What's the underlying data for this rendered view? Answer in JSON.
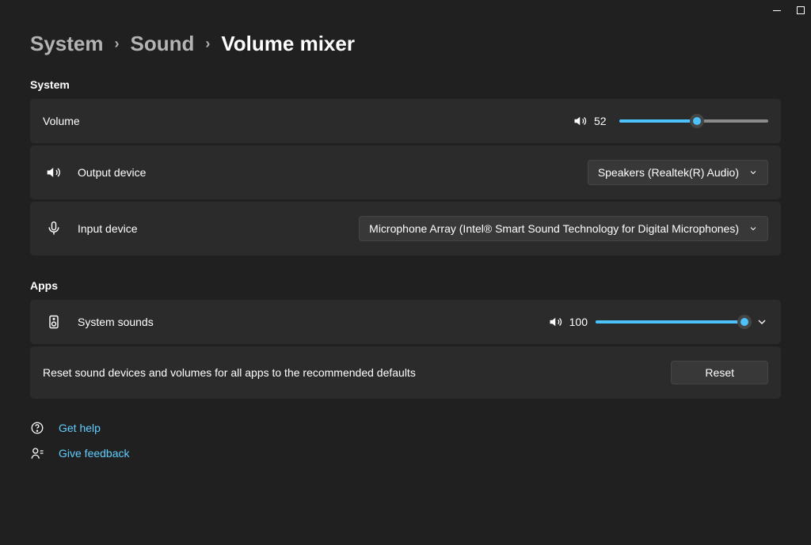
{
  "breadcrumb": {
    "item1": "System",
    "item2": "Sound",
    "current": "Volume mixer"
  },
  "sections": {
    "system_title": "System",
    "apps_title": "Apps"
  },
  "volume": {
    "label": "Volume",
    "value": "52",
    "percent": 52
  },
  "output": {
    "label": "Output device",
    "selected": "Speakers (Realtek(R) Audio)"
  },
  "input": {
    "label": "Input device",
    "selected": "Microphone Array (Intel® Smart Sound Technology for Digital Microphones)"
  },
  "apps": {
    "system_sounds_label": "System sounds",
    "system_sounds_value": "100",
    "system_sounds_percent": 100
  },
  "reset": {
    "text": "Reset sound devices and volumes for all apps to the recommended defaults",
    "button": "Reset"
  },
  "links": {
    "help": "Get help",
    "feedback": "Give feedback"
  }
}
